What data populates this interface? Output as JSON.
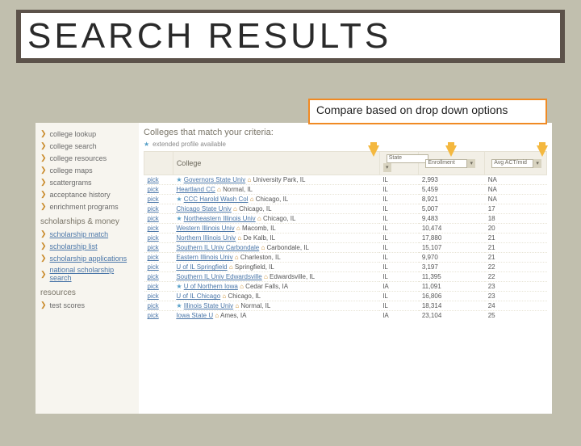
{
  "title": "SEARCH RESULTS",
  "callout": "Compare based on drop down options",
  "sidebar": {
    "nav": [
      "college lookup",
      "college search",
      "college resources",
      "college maps",
      "scattergrams",
      "acceptance history",
      "enrichment programs"
    ],
    "scholarships_header": "scholarships & money",
    "scholarships": [
      "scholarship match",
      "scholarship list",
      "scholarship applications",
      "national scholarship search"
    ],
    "resources_header": "resources",
    "resources": [
      "test scores"
    ]
  },
  "main": {
    "criteria_label": "Colleges that match your criteria:",
    "legend": "extended profile available",
    "headers": {
      "college": "College",
      "state": "State",
      "enrollment": "Enrollment",
      "act": "Avg ACT/mid"
    },
    "pick_label": "pick",
    "rows": [
      {
        "star": true,
        "name": "Governors State Univ",
        "loc": "University Park, IL",
        "state": "IL",
        "enr": "2,993",
        "act": "NA"
      },
      {
        "star": false,
        "name": "Heartland CC",
        "loc": "Normal, IL",
        "state": "IL",
        "enr": "5,459",
        "act": "NA"
      },
      {
        "star": true,
        "name": "CCC Harold Wash Col",
        "loc": "Chicago, IL",
        "state": "IL",
        "enr": "8,921",
        "act": "NA"
      },
      {
        "star": false,
        "name": "Chicago State Univ",
        "loc": "Chicago, IL",
        "state": "IL",
        "enr": "5,007",
        "act": "17"
      },
      {
        "star": true,
        "name": "Northeastern Illinois Univ",
        "loc": "Chicago, IL",
        "state": "IL",
        "enr": "9,483",
        "act": "18"
      },
      {
        "star": false,
        "name": "Western Illinois Univ",
        "loc": "Macomb, IL",
        "state": "IL",
        "enr": "10,474",
        "act": "20"
      },
      {
        "star": false,
        "name": "Northern Illinois Univ",
        "loc": "De Kalb, IL",
        "state": "IL",
        "enr": "17,880",
        "act": "21"
      },
      {
        "star": false,
        "name": "Southern IL Univ Carbondale",
        "loc": "Carbondale, IL",
        "state": "IL",
        "enr": "15,107",
        "act": "21"
      },
      {
        "star": false,
        "name": "Eastern Illinois Univ",
        "loc": "Charleston, IL",
        "state": "IL",
        "enr": "9,970",
        "act": "21"
      },
      {
        "star": false,
        "name": "U of IL Springfield",
        "loc": "Springfield, IL",
        "state": "IL",
        "enr": "3,197",
        "act": "22"
      },
      {
        "star": false,
        "name": "Southern IL Univ Edwardsville",
        "loc": "Edwardsville, IL",
        "state": "IL",
        "enr": "11,395",
        "act": "22"
      },
      {
        "star": true,
        "name": "U of Northern Iowa",
        "loc": "Cedar Falls, IA",
        "state": "IA",
        "enr": "11,091",
        "act": "23"
      },
      {
        "star": false,
        "name": "U of IL Chicago",
        "loc": "Chicago, IL",
        "state": "IL",
        "enr": "16,806",
        "act": "23"
      },
      {
        "star": true,
        "name": "Illinois State Univ",
        "loc": "Normal, IL",
        "state": "IL",
        "enr": "18,314",
        "act": "24"
      },
      {
        "star": false,
        "name": "Iowa State U",
        "loc": "Ames, IA",
        "state": "IA",
        "enr": "23,104",
        "act": "25"
      }
    ]
  }
}
